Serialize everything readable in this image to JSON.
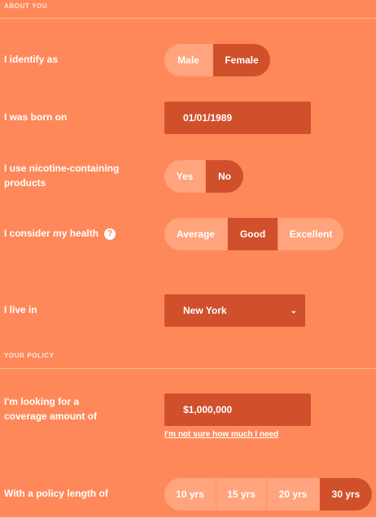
{
  "about": {
    "title": "ABOUT YOU"
  },
  "gender": {
    "label": "I identify as",
    "options": [
      "Male",
      "Female"
    ],
    "selected": "Female"
  },
  "birth": {
    "label": "I was born on",
    "value": "01/01/1989"
  },
  "nicotine": {
    "label": "I use nicotine-containing products",
    "options": [
      "Yes",
      "No"
    ],
    "selected": "No"
  },
  "health": {
    "label": "I consider my health",
    "help_icon": "?",
    "options": [
      "Average",
      "Good",
      "Excellent"
    ],
    "selected": "Good"
  },
  "location": {
    "label": "I live in",
    "value": "New York",
    "chevron": "⌄"
  },
  "policy": {
    "title": "YOUR POLICY"
  },
  "coverage": {
    "label": "I'm looking for a coverage amount of",
    "value": "$1,000,000",
    "help_link": "I'm not sure how much I need"
  },
  "length": {
    "label": "With a policy length of",
    "options": [
      "10 yrs",
      "15 yrs",
      "20 yrs",
      "30 yrs"
    ],
    "selected": "30 yrs"
  },
  "colors": {
    "background": "#ff885a",
    "active": "#d0502c",
    "inactive": "#ffa47d"
  }
}
